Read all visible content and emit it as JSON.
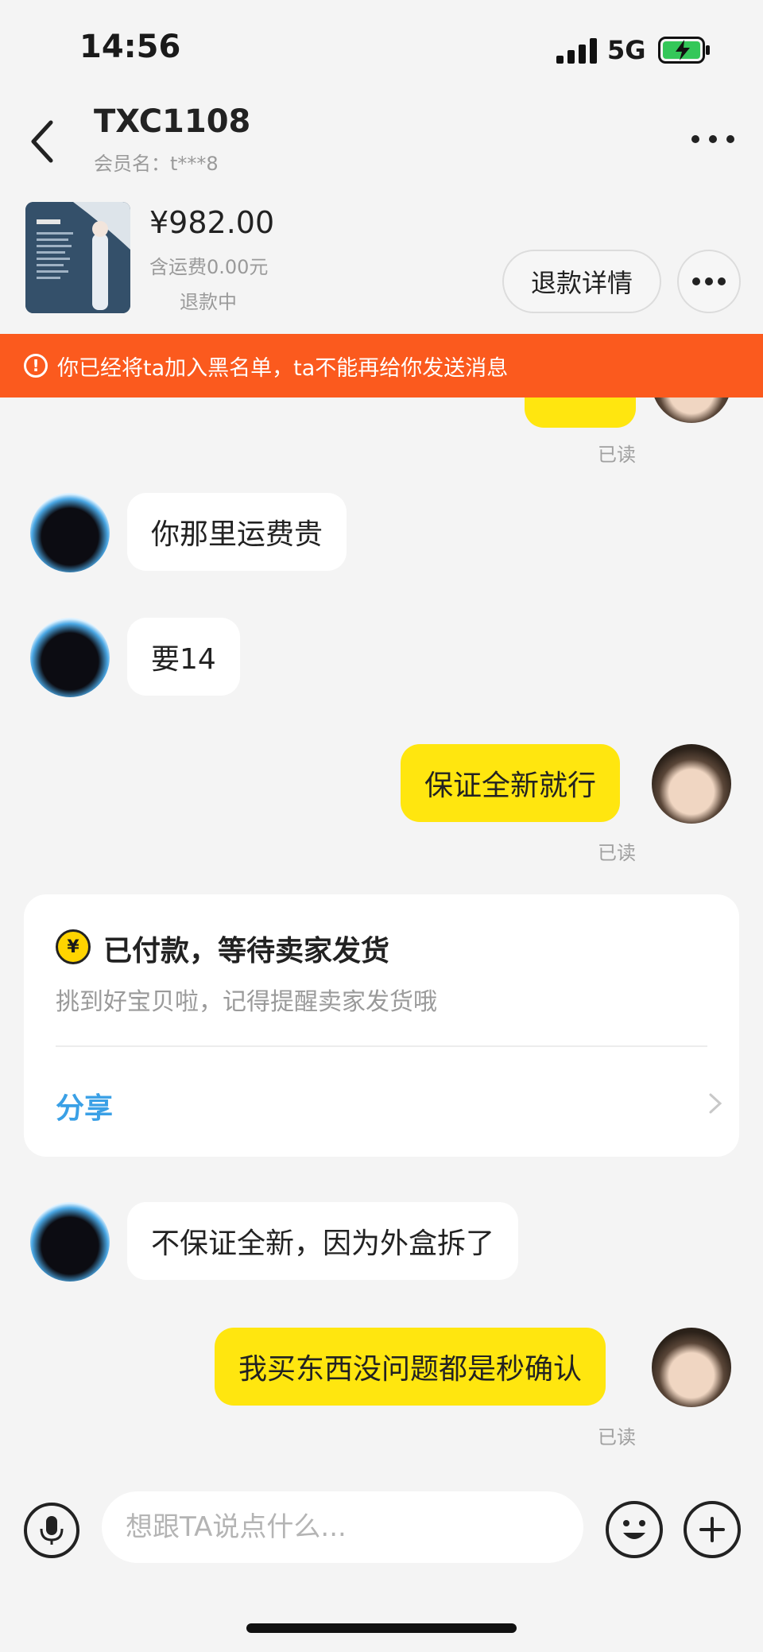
{
  "status_bar": {
    "time": "14:56",
    "network": "5G",
    "icons": [
      "signal-icon",
      "battery-charging-icon"
    ]
  },
  "header": {
    "title": "TXC1108",
    "member": "会员名：t***8",
    "icons": [
      "back-icon",
      "more-icon"
    ]
  },
  "product": {
    "price": "¥982.00",
    "shipping": "含运费0.00元",
    "status": "退款中",
    "refund_button": "退款详情"
  },
  "banner": {
    "text": "你已经将ta加入黑名单，ta不能再给你发送消息",
    "icon": "warning-icon"
  },
  "messages": [
    {
      "side": "right",
      "text": "",
      "read": "已读"
    },
    {
      "side": "left",
      "text": "你那里运费贵"
    },
    {
      "side": "left",
      "text": "要14"
    },
    {
      "side": "right",
      "text": "保证全新就行",
      "read": "已读"
    },
    {
      "side": "left",
      "text": "不保证全新，因为外盒拆了"
    },
    {
      "side": "right",
      "text": "我买东西没问题都是秒确认",
      "read": "已读"
    }
  ],
  "order_card": {
    "icon": "yen-icon",
    "title": "已付款，等待卖家发货",
    "description": "挑到好宝贝啦，记得提醒卖家发货哦",
    "share": "分享"
  },
  "composer": {
    "placeholder": "想跟TA说点什么...",
    "icons": [
      "microphone-icon",
      "emoji-icon",
      "plus-icon"
    ]
  },
  "colors": {
    "accent_yellow": "#ffe60f",
    "banner_orange": "#fb5a1e",
    "link_blue": "#3aa0e6"
  }
}
